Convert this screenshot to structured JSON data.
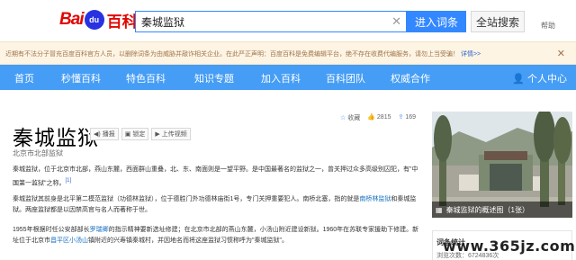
{
  "header": {
    "logo_bai": "Bai",
    "logo_du": "du",
    "logo_baike": "百科",
    "search_value": "秦城监狱",
    "enter_label": "进入词条",
    "search_label": "全站搜索",
    "help_label": "帮助"
  },
  "notice": {
    "text": "近期有不法分子冒充百度百科官方人员，以删除词条为由威胁并敲诈相关企业。在此严正声明：百度百科是免费编辑平台，绝不存在收费代编服务，请勿上当受骗！",
    "link": "详情>>"
  },
  "nav": {
    "items": [
      "首页",
      "秒懂百科",
      "特色百科",
      "知识专题",
      "加入百科",
      "百科团队",
      "权威合作"
    ],
    "user": "个人中心"
  },
  "article": {
    "title": "秦城监狱",
    "buttons": [
      "播报",
      "锁定",
      "上传视频"
    ],
    "stats": {
      "collect": "收藏",
      "likes": "2815",
      "shares": "169"
    },
    "subtitle": "北京市北部监狱",
    "p1_a": "秦城监狱，位于北京市北部，燕山东麓，西面群山重叠，北、东、南面则是一望平野。是中国最著名的监狱之一，曾关押过众多高级别囚犯，有\"中国第一监狱\"之称。",
    "p1_ref": "[1]",
    "p2_a": "秦城监狱其前身是北平第二模范监狱（功德林监狱），位于德胜门外功德林庙街1号，专门关押重要犯人。南桥北塞，指的就是",
    "p2_link1": "南桥林监狱",
    "p2_b": "和秦城监狱。两座监狱都是以因禁高官与名人而著称于世。",
    "p3_a": "1955年根据时任公安部部长",
    "p3_link1": "罗瑞卿",
    "p3_b": "的指示精神要新选址修建；在北京市北部的燕山东麓，小汤山附近建设新狱。1960年在苏联专家援助下修建。新址位于北京市",
    "p3_link2": "昌平区",
    "p3_link3": "小汤山",
    "p3_c": "镇附近的兴寿镇秦城村，并因地名而将这座监狱习惯称呼为\"秦城监狱\"。"
  },
  "album": {
    "caption": "秦城监狱的概述图（1张）"
  },
  "entry_stats": {
    "title": "词条统计",
    "views": "浏览次数：6724836次"
  },
  "watermark": "www.365jz.com"
}
